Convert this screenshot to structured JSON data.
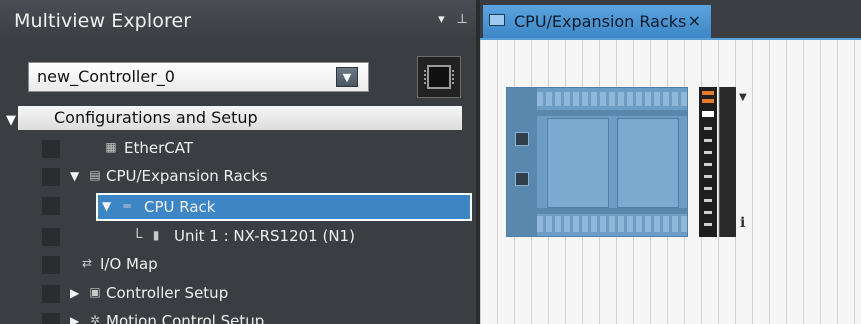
{
  "explorer": {
    "title": "Multiview Explorer",
    "pin_icon": "pin-icon",
    "dropdown_icon": "chevron-down-icon",
    "controller_select": {
      "value": "new_Controller_0"
    },
    "controller_icon": "controller-icon"
  },
  "tree": {
    "section_label": "Configurations and Setup",
    "items": [
      {
        "label": "EtherCAT",
        "icon": "ethercat-icon"
      },
      {
        "label": "CPU/Expansion Racks",
        "icon": "racks-icon"
      },
      {
        "label": "CPU Rack",
        "icon": "rack-icon",
        "selected": true
      },
      {
        "label": "Unit 1 : NX-RS1201 (N1)",
        "icon": "unit-icon",
        "prefix": "L"
      },
      {
        "label": "I/O Map",
        "icon": "io-map-icon"
      },
      {
        "label": "Controller Setup",
        "icon": "controller-setup-icon"
      },
      {
        "label": "Motion Control Setup",
        "icon": "motion-control-icon"
      }
    ]
  },
  "editor": {
    "tab_label": "CPU/Expansion Racks",
    "tab_close": "×",
    "info_glyph": "i"
  },
  "colors": {
    "accent": "#3d86c6",
    "pane_bg": "#3a3d41",
    "canvas_bg": "#f5f5f5",
    "module_blue": "#6d9cc4"
  }
}
